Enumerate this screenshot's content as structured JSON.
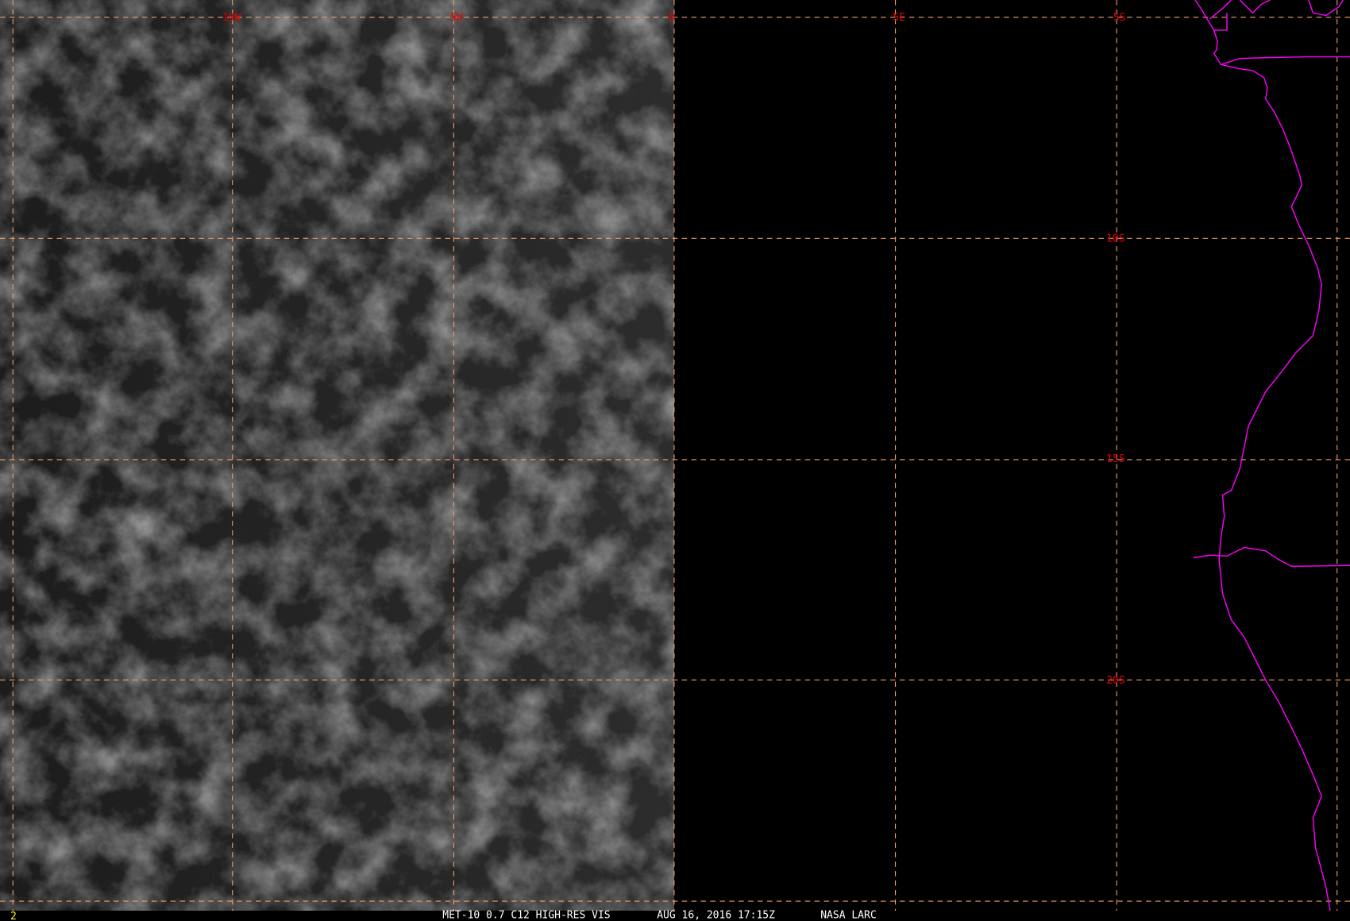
{
  "map": {
    "lon_labels": [
      "10W",
      "5W",
      "0",
      "5E"
    ],
    "lat_labels": [
      "5S",
      "10S",
      "15S",
      "20S"
    ],
    "frame_number": "2",
    "caption": {
      "product": "MET-10 0.7 C12 HIGH-RES VIS",
      "datetime": "AUG 16, 2016 17:15Z",
      "source": "NASA LARC"
    },
    "colors": {
      "grid": "#f0a070",
      "grid_label": "#e80000",
      "coastline": "#ff00ff",
      "frame_number": "#ffff00",
      "caption": "#ffffff"
    }
  }
}
